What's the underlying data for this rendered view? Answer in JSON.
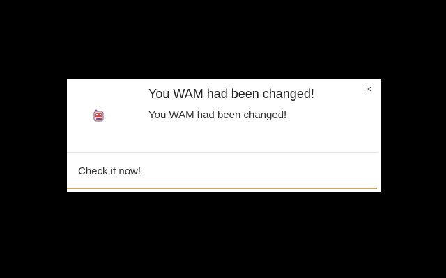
{
  "notification": {
    "title": "You WAM had been changed!",
    "message": "You WAM had been changed!",
    "action_label": "Check it now!",
    "close_glyph": "×",
    "icon": "app-extension-icon",
    "colors": {
      "background": "#000000",
      "card": "#ffffff",
      "accent_underline": "#c8a96e"
    }
  }
}
